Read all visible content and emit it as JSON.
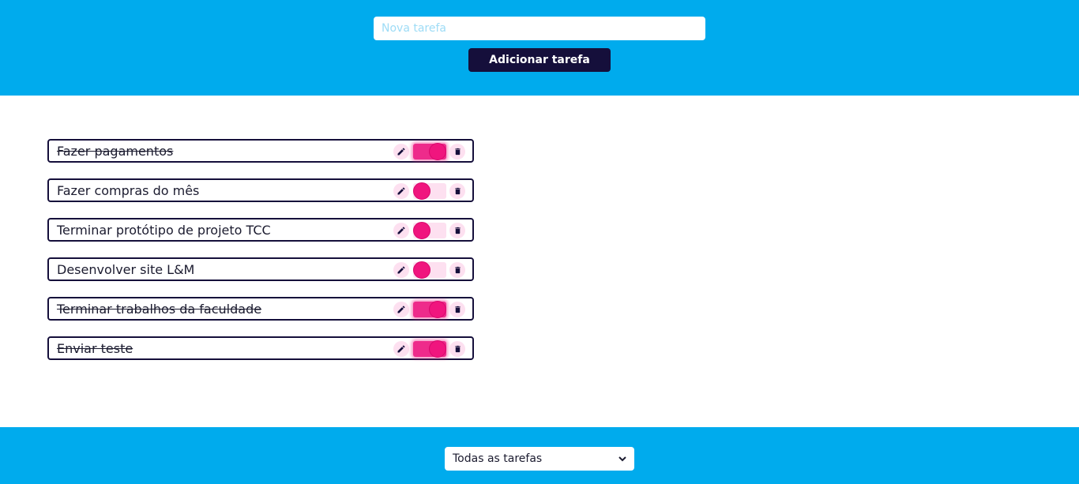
{
  "header": {
    "input_placeholder": "Nova tarefa",
    "input_value": "",
    "add_button_label": "Adicionar tarefa"
  },
  "tasks": [
    {
      "text": "Fazer pagamentos",
      "done": true
    },
    {
      "text": "Fazer compras do mês",
      "done": false
    },
    {
      "text": "Terminar protótipo de projeto TCC",
      "done": false
    },
    {
      "text": "Desenvolver site L&M",
      "done": false
    },
    {
      "text": "Terminar trabalhos da faculdade",
      "done": true
    },
    {
      "text": "Enviar teste",
      "done": true
    }
  ],
  "footer": {
    "filter_selected": "Todas as tarefas"
  },
  "icons": {
    "edit": "pencil-icon",
    "delete": "trash-icon",
    "dropdown": "chevron-down-icon"
  },
  "colors": {
    "header_bg": "#00abed",
    "button_bg": "#150f3b",
    "accent": "#f0157e",
    "accent_light": "#fde0f0"
  }
}
